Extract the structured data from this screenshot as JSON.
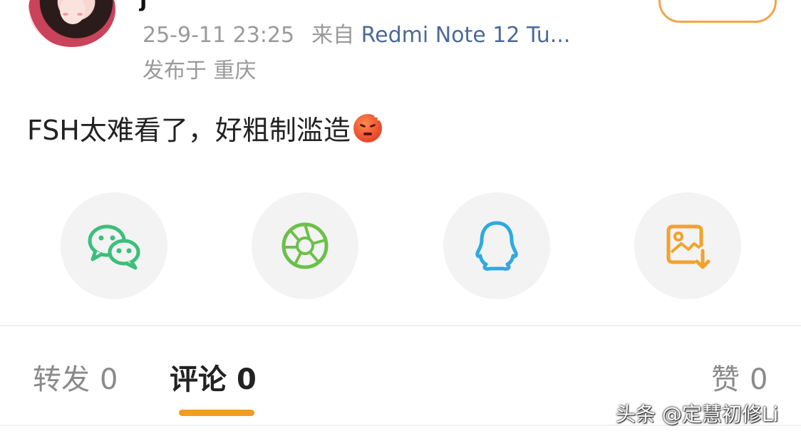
{
  "post": {
    "username_fragment": "j​",
    "timestamp": "25-9-11 23:25",
    "source_prefix": "来自",
    "device": "Redmi Note 12 Tu...",
    "location": "发布于 重庆",
    "content": "FSH太难看了，好粗制滥造"
  },
  "share": [
    {
      "icon": "wechat-icon",
      "color": "#3bbf7a"
    },
    {
      "icon": "moments-icon",
      "color": "#6cc04a"
    },
    {
      "icon": "qq-icon",
      "color": "#2fa9e0"
    },
    {
      "icon": "save-image-icon",
      "color": "#f3a22b"
    }
  ],
  "tabs": [
    {
      "label": "转发",
      "count": "0"
    },
    {
      "label": "评论",
      "count": "0"
    },
    {
      "label": "赞",
      "count": "0"
    }
  ],
  "colors": {
    "accent": "#f39c1e",
    "device_link": "#4b6a9a",
    "muted": "#9a9a9a"
  },
  "watermark": "头条 @定慧初修Li"
}
